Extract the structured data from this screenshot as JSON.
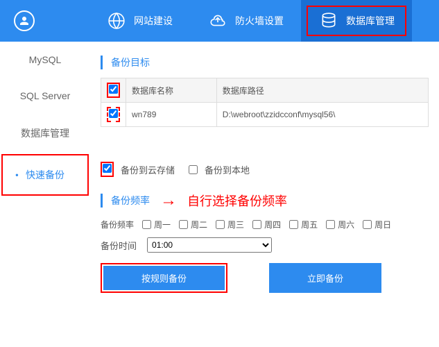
{
  "nav": {
    "items": [
      {
        "label": "网站建设"
      },
      {
        "label": "防火墙设置"
      },
      {
        "label": "数据库管理"
      }
    ]
  },
  "sidebar": {
    "items": [
      {
        "label": "MySQL"
      },
      {
        "label": "SQL Server"
      },
      {
        "label": "数据库管理"
      },
      {
        "label": "快速备份"
      }
    ]
  },
  "sections": {
    "backup_target": "备份目标",
    "backup_freq": "备份频率"
  },
  "table": {
    "headers": {
      "name": "数据库名称",
      "path": "数据库路径"
    },
    "rows": [
      {
        "name": "wn789",
        "path": "D:\\webroot\\zzidcconf\\mysql56\\"
      }
    ]
  },
  "options": {
    "cloud": "备份到云存储",
    "local": "备份到本地"
  },
  "freq": {
    "label": "备份频率",
    "days": [
      "周一",
      "周二",
      "周三",
      "周四",
      "周五",
      "周六",
      "周日"
    ],
    "time_label": "备份时间",
    "time_value": "01:00"
  },
  "annotation": "自行选择备份频率",
  "buttons": {
    "rule": "按规则备份",
    "now": "立即备份"
  }
}
